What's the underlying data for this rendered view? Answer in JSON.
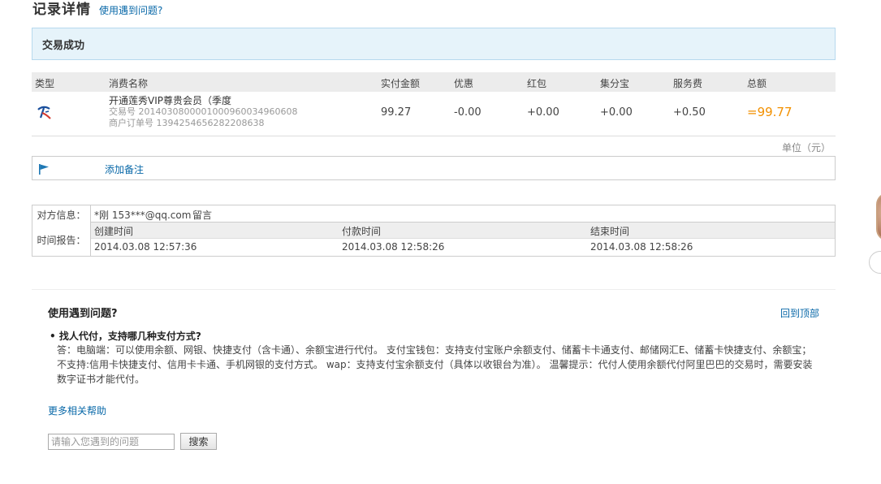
{
  "header": {
    "title": "记录详情",
    "help_link": "使用遇到问题?"
  },
  "status": {
    "text": "交易成功"
  },
  "record_table": {
    "headers": [
      "类型",
      "消费名称",
      "实付金额",
      "优惠",
      "红包",
      "集分宝",
      "服务费",
      "总额"
    ],
    "row": {
      "type_icon": "alipay-logo-icon",
      "name": "开通莲秀VIP尊贵会员（季度",
      "trade_no": "交易号 2014030800001000960034960608",
      "order_no": "商户订单号 1394254656282208638",
      "paid": "99.27",
      "discount": "-0.00",
      "red_packet": "+0.00",
      "jifenbao": "+0.00",
      "service_fee": "+0.50",
      "total": "=99.77"
    }
  },
  "unit": "单位（元）",
  "remark": {
    "icon": "flag-icon",
    "link": "添加备注"
  },
  "counterparty": {
    "label": "对方信息：",
    "value": "*刚 153***@qq.com",
    "message_link": "留言"
  },
  "time_report": {
    "label": "时间报告：",
    "headers": [
      "创建时间",
      "付款时间",
      "结束时间"
    ],
    "values": [
      "2014.03.08 12:57:36",
      "2014.03.08 12:58:26",
      "2014.03.08 12:58:26"
    ]
  },
  "help": {
    "title": "使用遇到问题?",
    "back_top": "回到顶部",
    "question": "• 找人代付，支持哪几种支付方式?",
    "answer": "答：电脑端：可以使用余额、网银、快捷支付（含卡通）、余额宝进行代付。 支付宝钱包：支持支付宝账户余额支付、储蓄卡卡通支付、邮储网汇E、储蓄卡快捷支付、余额宝；不支持:信用卡快捷支付、信用卡卡通、手机网银的支付方式。 wap：支持支付宝余额支付（具体以收银台为准）。 温馨提示：代付人使用余额代付阿里巴巴的交易时，需要安装数字证书才能代付。",
    "more_link": "更多相关帮助",
    "search_placeholder": "请输入您遇到的问题",
    "search_button": "搜索"
  },
  "colors": {
    "accent": "#0868a8",
    "total": "#f29000",
    "status_bg": "#e6f3fa"
  }
}
